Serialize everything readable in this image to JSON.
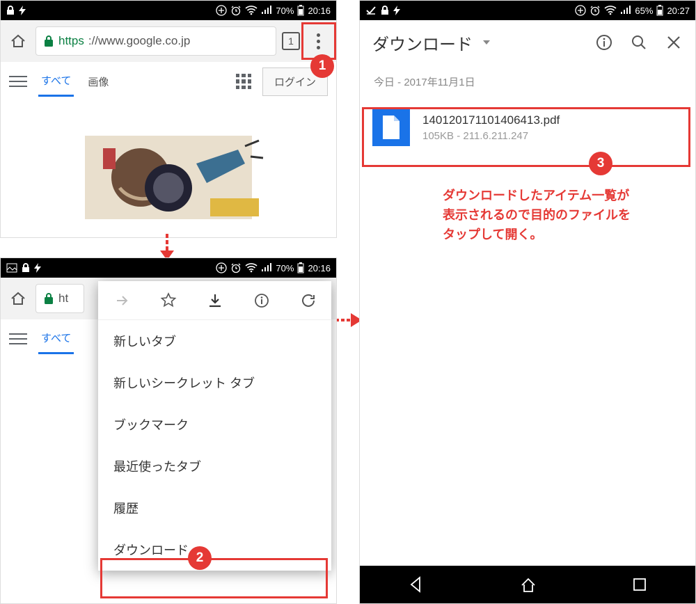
{
  "callouts": {
    "one": "1",
    "two": "2",
    "three": "3"
  },
  "phone1": {
    "status": {
      "battery_pct": "70%",
      "time": "20:16"
    },
    "url": {
      "https": "https",
      "rest": "://www.google.co.jp"
    },
    "tabcount": "1",
    "tabs": {
      "all": "すべて",
      "images": "画像"
    },
    "login": "ログイン"
  },
  "phone2": {
    "status": {
      "battery_pct": "70%",
      "time": "20:16"
    },
    "url_prefix": "ht",
    "tabs_all": "すべて",
    "menu": {
      "new_tab": "新しいタブ",
      "incognito": "新しいシークレット タブ",
      "bookmarks": "ブックマーク",
      "recent": "最近使ったタブ",
      "history": "履歴",
      "downloads": "ダウンロード"
    }
  },
  "phone3": {
    "status": {
      "battery_pct": "65%",
      "time": "20:27"
    },
    "title": "ダウンロード",
    "date": "今日 - 2017年11月1日",
    "file": {
      "name": "140120171101406413.pdf",
      "size": "105KB",
      "sep": " - ",
      "host": "211.6.211.247"
    }
  },
  "caption": "ダウンロードしたアイテム一覧が\n表示されるので目的のファイルを\nタップして開く。"
}
